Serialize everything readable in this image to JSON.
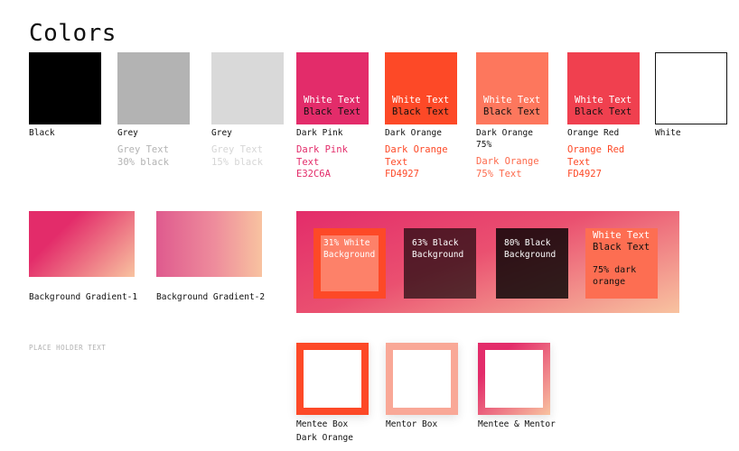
{
  "title": "Colors",
  "swatches": [
    {
      "label": "Black",
      "color": "#000000"
    },
    {
      "label": "Grey",
      "color": "#b3b3b3",
      "sub": [
        "Grey Text",
        "30% black"
      ],
      "sub_color": "#b3b3b3"
    },
    {
      "label": "Grey",
      "color": "#d9d9d9",
      "sub": [
        "Grey Text",
        "15% black"
      ],
      "sub_color": "#d9d9d9"
    },
    {
      "label": "Dark Pink",
      "color": "#E32C6A",
      "white_text": "White Text",
      "black_text": "Black Text",
      "sub": [
        "Dark Pink",
        "Text",
        "E32C6A"
      ],
      "sub_color": "#E32C6A"
    },
    {
      "label": "Dark Orange",
      "color": "#FD4927",
      "white_text": "White Text",
      "black_text": "Black Text",
      "sub": [
        "Dark Orange",
        "Text",
        "FD4927"
      ],
      "sub_color": "#FD4927"
    },
    {
      "label": [
        "Dark Orange",
        "75%"
      ],
      "color": "#fd775d",
      "white_text": "White Text",
      "black_text": "Black Text",
      "sub": [
        "Dark Orange",
        "75% Text"
      ],
      "sub_color": "#fd775d"
    },
    {
      "label": "Orange Red",
      "color": "#F0404F",
      "white_text": "White Text",
      "black_text": "Black Text",
      "sub": [
        "Orange Red",
        "Text",
        "FD4927"
      ],
      "sub_color": "#FD4927"
    },
    {
      "label": "White",
      "color": "#ffffff"
    }
  ],
  "gradients": [
    {
      "label": "Background Gradient-1",
      "from": "#E32C6A",
      "to": "#f8c3a0"
    },
    {
      "label": "Background Gradient-2",
      "from": "#e05088",
      "to": "#f8c3a0"
    }
  ],
  "overlays": [
    {
      "lines": [
        "31% White",
        "Background"
      ]
    },
    {
      "lines": [
        "63% Black",
        "Background"
      ]
    },
    {
      "lines": [
        "80% Black",
        "Background"
      ]
    }
  ],
  "orange_card": {
    "white_text": "White Text",
    "black_text": "Black Text",
    "note": [
      "75% dark",
      "orange"
    ]
  },
  "placeholder": "PLACE HOLDER TEXT",
  "boxes": [
    {
      "label": [
        "Mentee Box",
        "Dark Orange"
      ]
    },
    {
      "label": [
        "Mentor Box"
      ]
    },
    {
      "label": [
        "Mentee & Mentor"
      ]
    }
  ]
}
